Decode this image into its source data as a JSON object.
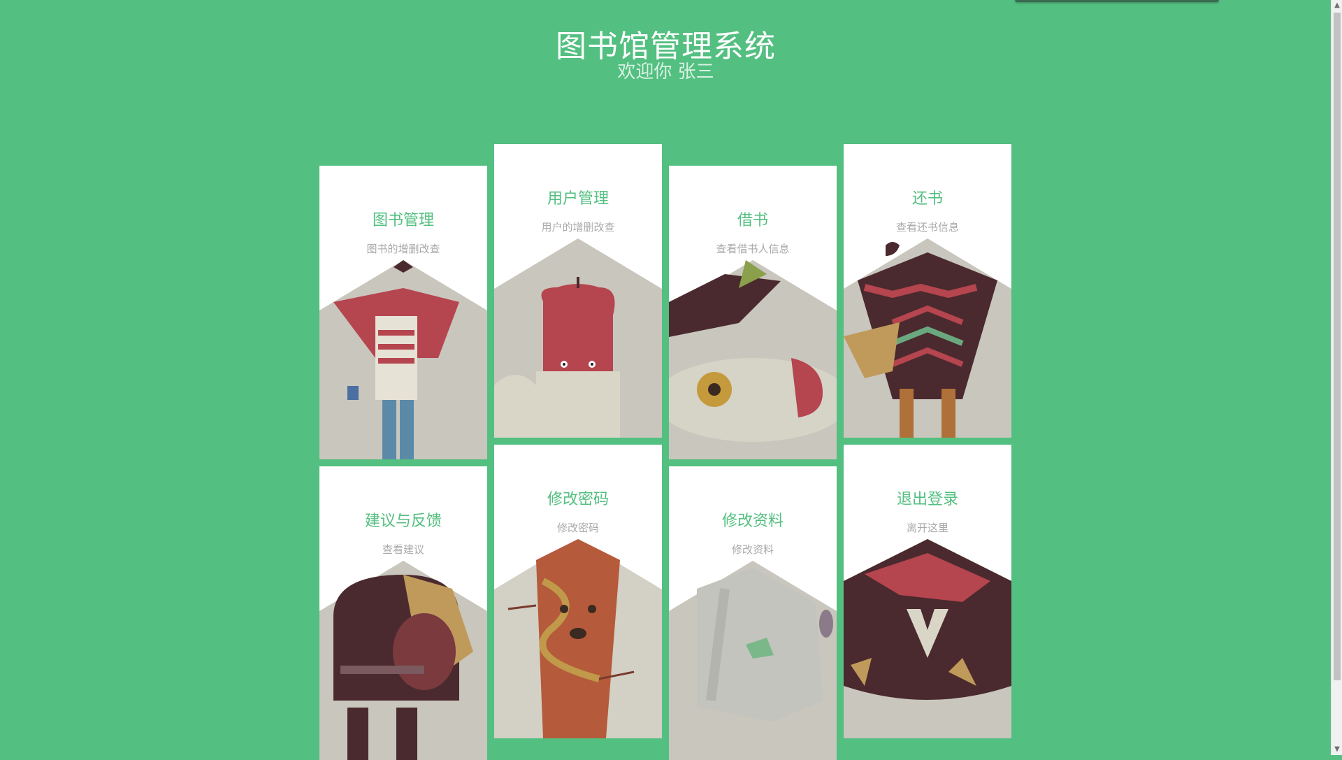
{
  "header": {
    "title": "图书馆管理系统",
    "welcome": "欢迎你 张三"
  },
  "colors": {
    "background": "#53bf80",
    "card": "#ffffff",
    "card_title": "#53bf80",
    "card_desc": "#a9a9a9"
  },
  "cards": [
    {
      "title": "图书管理",
      "desc": "图书的增删改查",
      "icon": "zombie-illustration"
    },
    {
      "title": "用户管理",
      "desc": "用户的增删改查",
      "icon": "apple-monster-illustration"
    },
    {
      "title": "借书",
      "desc": "查看借书人信息",
      "icon": "nuclear-bomb-illustration"
    },
    {
      "title": "还书",
      "desc": "查看还书信息",
      "icon": "poncho-creature-illustration"
    },
    {
      "title": "建议与反馈",
      "desc": "查看建议",
      "icon": "warrior-illustration"
    },
    {
      "title": "修改密码",
      "desc": "修改密码",
      "icon": "tree-illustration"
    },
    {
      "title": "修改资料",
      "desc": "修改资料",
      "icon": "elephant-illustration"
    },
    {
      "title": "退出登录",
      "desc": "离开这里",
      "icon": "penguin-suit-illustration"
    }
  ]
}
